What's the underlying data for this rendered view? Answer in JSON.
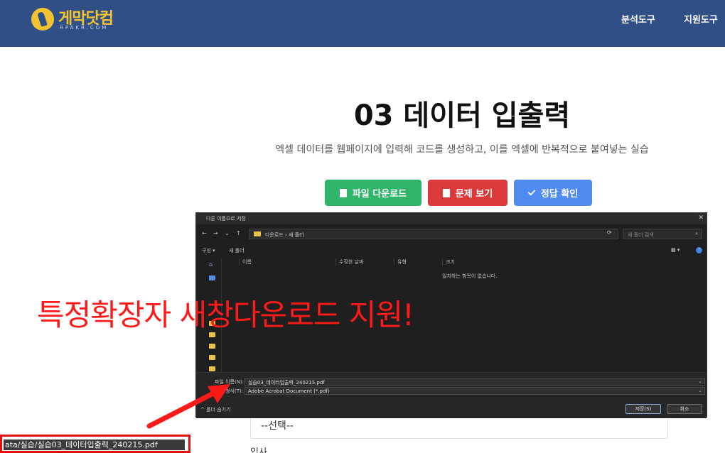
{
  "header": {
    "logo_text": "게막닷컴",
    "logo_sub": "RPAKR.COM",
    "nav": [
      "분석도구",
      "지원도구"
    ]
  },
  "main": {
    "title": "03 데이터 입출력",
    "subtitle": "엑셀 데이터를 웹페이지에 입력해 코드를 생성하고, 이를 엑셀에 반복적으로 붙여넣는 실습",
    "buttons": {
      "download": "파일 다운로드",
      "problem": "문제 보기",
      "answer": "정답 확인"
    },
    "select_value": "--선택--",
    "bottom_label": "입사"
  },
  "dialog": {
    "title": "다른 이름으로 저장",
    "path": "다운로드 › 새 폴더",
    "search_placeholder": "새 폴더 검색",
    "cmd_organize": "구성 ▾",
    "cmd_new_folder": "새 폴더",
    "columns": [
      "이름",
      "수정한 날짜",
      "유형",
      "크기"
    ],
    "empty_message": "일치하는 항목이 없습니다.",
    "filename_label": "파일 이름(N):",
    "filename_value": "실습03_데이터입출력_240215.pdf",
    "filetype_label": "파일 형식(T):",
    "filetype_value": "Adobe Acrobat Document (*.pdf)",
    "hide_folders": "^ 폴더 숨기기",
    "save_button": "저장(S)",
    "cancel_button": "취소"
  },
  "annotation": {
    "overlay_text": "특정확장자 새창다운로드 지원!",
    "download_path": "ata/실습/실습03_데이터입출력_240215.pdf",
    "colors": {
      "annotation": "#ff1a1a",
      "header": "#2f4f86",
      "logo": "#f4c430"
    }
  }
}
